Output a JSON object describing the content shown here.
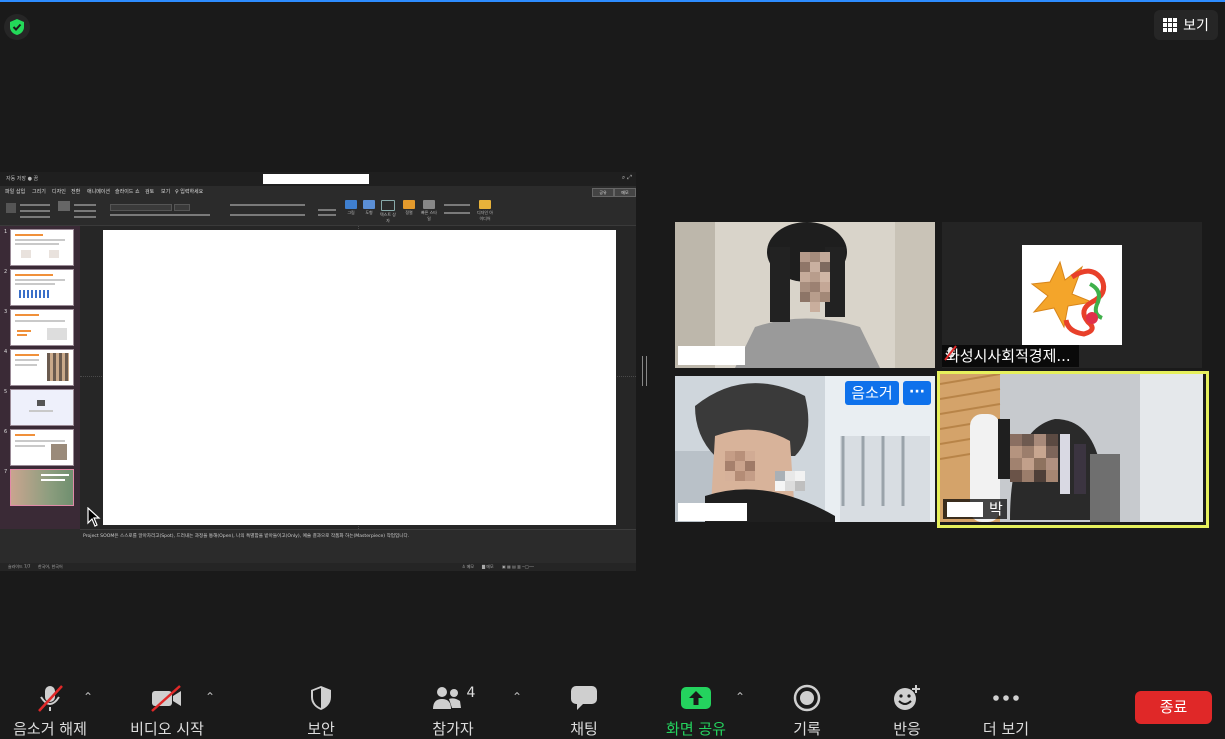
{
  "top_bar": {
    "view_label": "보기"
  },
  "shared_screen": {
    "titlebar_quick_text": "자동 저장 ● 끔",
    "ribbon_tabs": [
      "파일",
      "홈",
      "삽입",
      "그리기",
      "디자인",
      "전환",
      "애니메이션",
      "슬라이드 쇼",
      "검토",
      "보기",
      "♀ 입력하세요"
    ],
    "share_button": "공유",
    "comment_button": "메모",
    "ribbon_buttons": [
      "그림",
      "도형",
      "텍스트 상자",
      "정렬",
      "빠른 스타일",
      "디자인 아이디어"
    ],
    "slide_numbers": [
      "1",
      "2",
      "3",
      "4",
      "5",
      "6",
      "7"
    ],
    "notes_text": "Project SOOM은 스스로를 알아차리고(Spot), 드러내는 과정을 통해(Open), 나의 특별함을 받아들이고(Only), 예술 결과으로 작품화 하는(Masterpiece) 작업입니다.",
    "status_left": "슬라이드 7/7",
    "status_lang": "한국어, 한국어",
    "status_notes": "≙ 메모",
    "status_comments": "▇ 메모"
  },
  "participants": [
    {
      "id": "p1",
      "name_visible": ""
    },
    {
      "id": "p2",
      "name": "화성시사회적경제...",
      "muted": true
    },
    {
      "id": "p3",
      "name_visible": ""
    },
    {
      "id": "p4",
      "name": "박",
      "active_speaker": true
    }
  ],
  "tile_actions": {
    "mute_label": "음소거",
    "more_label": "···"
  },
  "toolbar": {
    "unmute": "음소거 해제",
    "start_video": "비디오 시작",
    "security": "보안",
    "participants": "참가자",
    "participants_count": "4",
    "chat": "채팅",
    "share_screen": "화면 공유",
    "record": "기록",
    "reactions": "반응",
    "more": "더 보기",
    "end": "종료"
  },
  "colors": {
    "accent_blue": "#0e71eb",
    "share_green": "#24d35e",
    "end_red": "#e02828",
    "active_speaker_border": "#e6f05c",
    "security_green": "#23d959"
  }
}
